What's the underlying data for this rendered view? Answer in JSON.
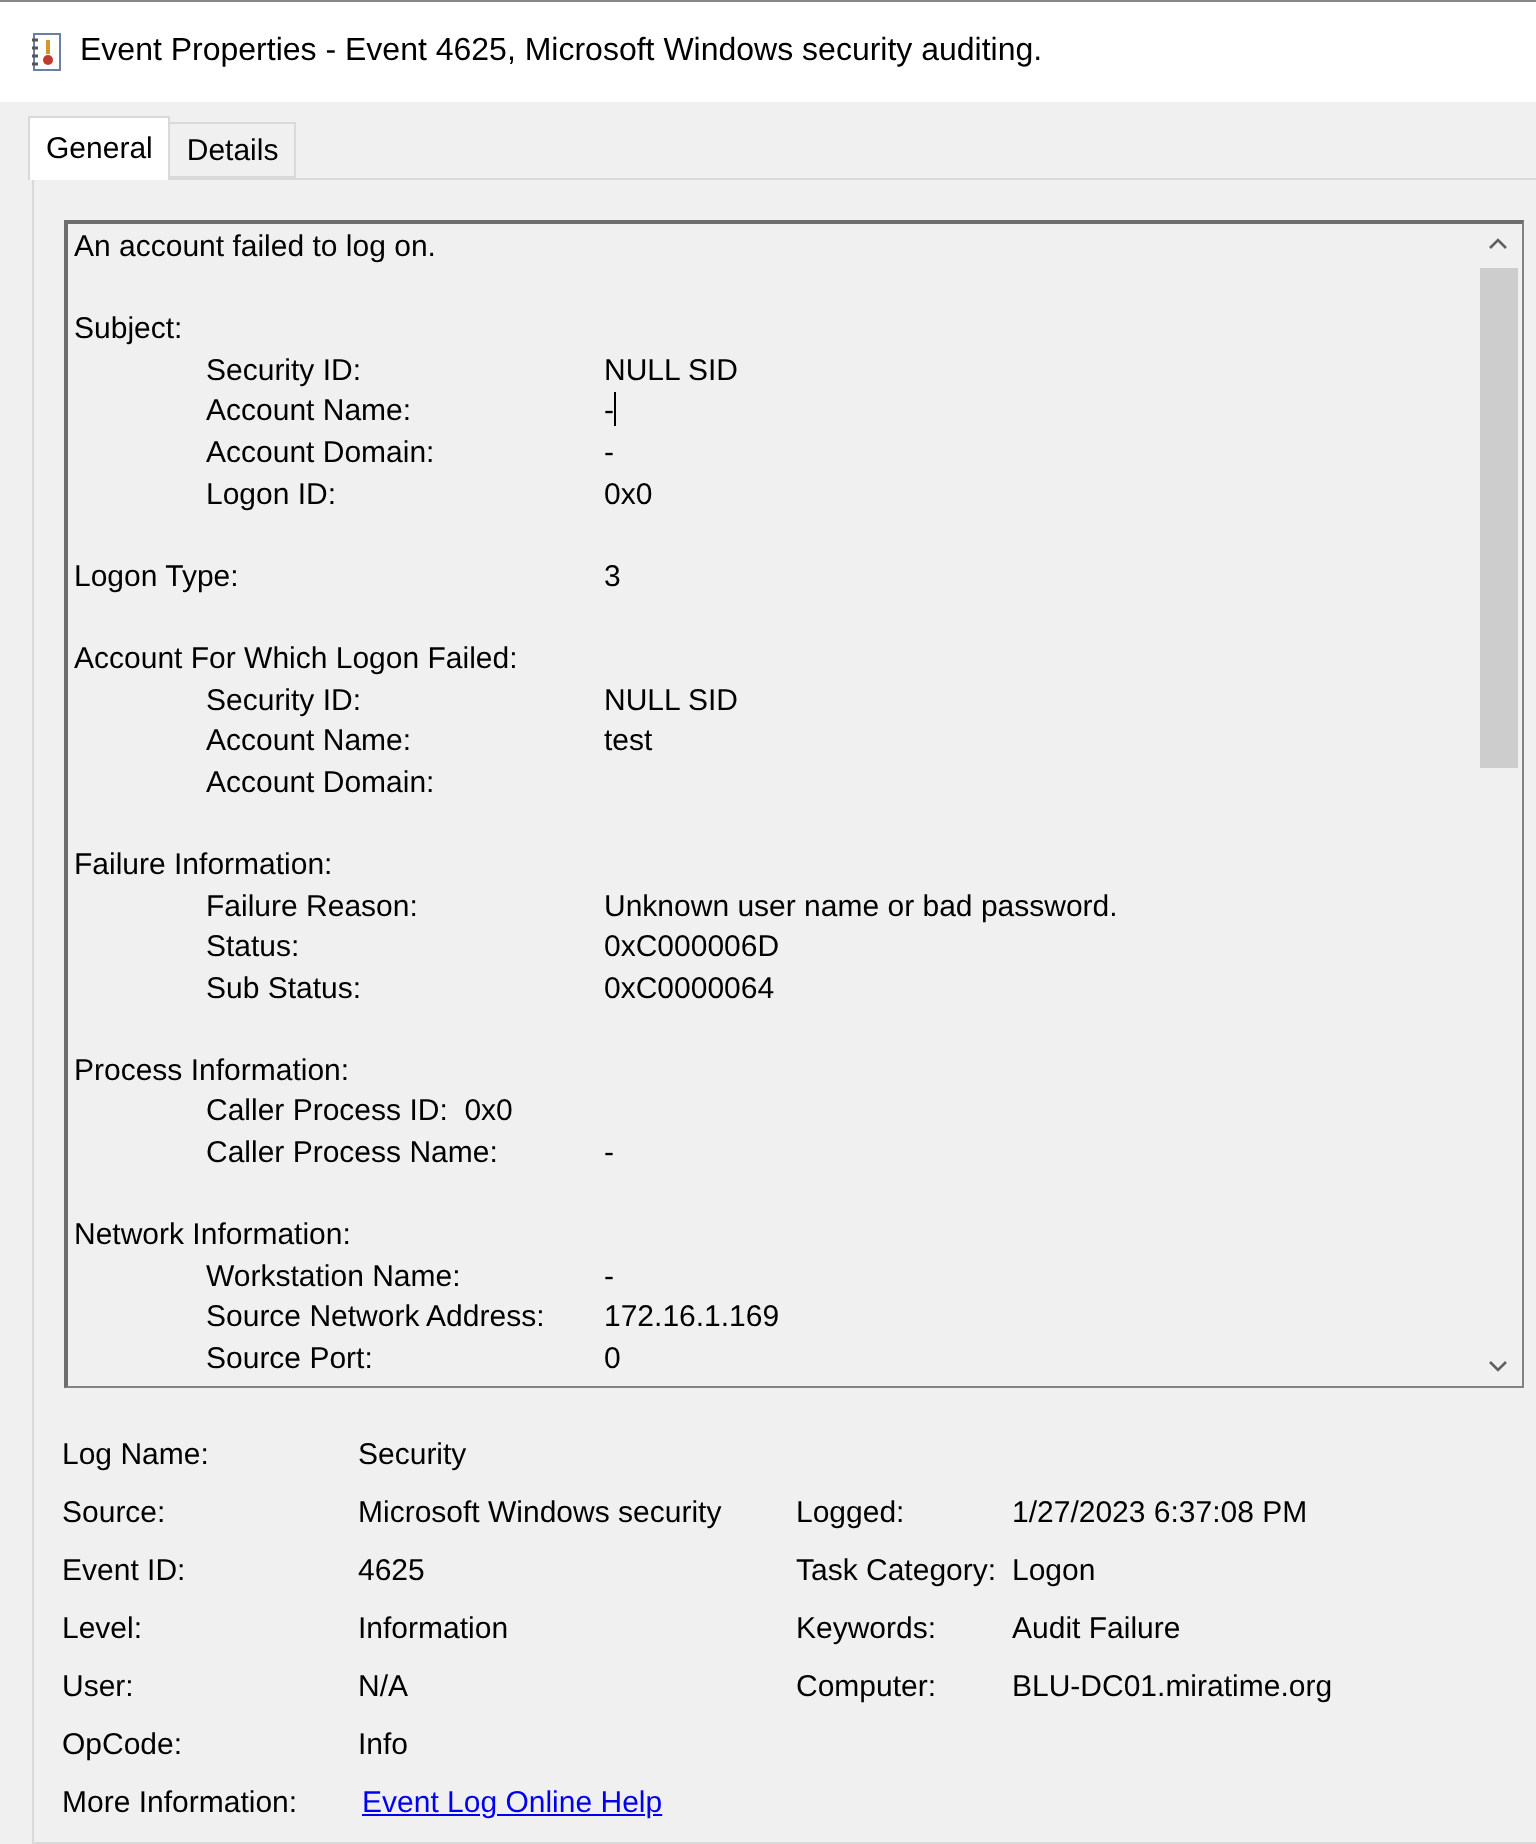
{
  "window": {
    "title": "Event Properties - Event 4625, Microsoft Windows security auditing."
  },
  "tabs": [
    {
      "label": "General",
      "selected": true
    },
    {
      "label": "Details",
      "selected": false
    }
  ],
  "description": [
    {
      "kind": "sentence",
      "text": "An account failed to log on."
    },
    {
      "kind": "heading",
      "text": "Subject:"
    },
    {
      "kind": "field",
      "label": "Security ID:",
      "value": "NULL SID"
    },
    {
      "kind": "field",
      "label": "Account Name:",
      "value": "-",
      "caret": true
    },
    {
      "kind": "field",
      "label": "Account Domain:",
      "value": "-"
    },
    {
      "kind": "field",
      "label": "Logon ID:",
      "value": "0x0"
    },
    {
      "kind": "top_field",
      "label": "Logon Type:",
      "value": "3"
    },
    {
      "kind": "heading",
      "text": "Account For Which Logon Failed:"
    },
    {
      "kind": "field",
      "label": "Security ID:",
      "value": "NULL SID"
    },
    {
      "kind": "field",
      "label": "Account Name:",
      "value": "test"
    },
    {
      "kind": "field",
      "label": "Account Domain:"
    },
    {
      "kind": "heading",
      "text": "Failure Information:"
    },
    {
      "kind": "field",
      "label": "Failure Reason:",
      "value": "Unknown user name or bad password."
    },
    {
      "kind": "field",
      "label": "Status:",
      "value": "0xC000006D"
    },
    {
      "kind": "field",
      "label": "Sub Status:",
      "value": "0xC0000064"
    },
    {
      "kind": "heading",
      "text": "Process Information:"
    },
    {
      "kind": "inline_field",
      "text": "Caller Process ID:  0x0"
    },
    {
      "kind": "field",
      "label": "Caller Process Name:",
      "value": "-"
    },
    {
      "kind": "heading",
      "text": "Network Information:"
    },
    {
      "kind": "field",
      "label": "Workstation Name:",
      "value": "-"
    },
    {
      "kind": "field",
      "label": "Source Network Address:",
      "value": "172.16.1.169"
    },
    {
      "kind": "field",
      "label": "Source Port:",
      "value": "0"
    }
  ],
  "properties": [
    [
      {
        "label": "Log Name:",
        "value": "Security"
      }
    ],
    [
      {
        "label": "Source:",
        "value": "Microsoft Windows security"
      },
      {
        "label": "Logged:",
        "value": "1/27/2023 6:37:08 PM"
      }
    ],
    [
      {
        "label": "Event ID:",
        "value": "4625"
      },
      {
        "label": "Task Category:",
        "value": "Logon"
      }
    ],
    [
      {
        "label": "Level:",
        "value": "Information"
      },
      {
        "label": "Keywords:",
        "value": "Audit Failure"
      }
    ],
    [
      {
        "label": "User:",
        "value": "N/A"
      },
      {
        "label": "Computer:",
        "value": "BLU-DC01.miratime.org"
      }
    ],
    [
      {
        "label": "OpCode:",
        "value": "Info"
      }
    ],
    [
      {
        "label": "More Information:",
        "link": "Event Log Online Help"
      }
    ]
  ]
}
